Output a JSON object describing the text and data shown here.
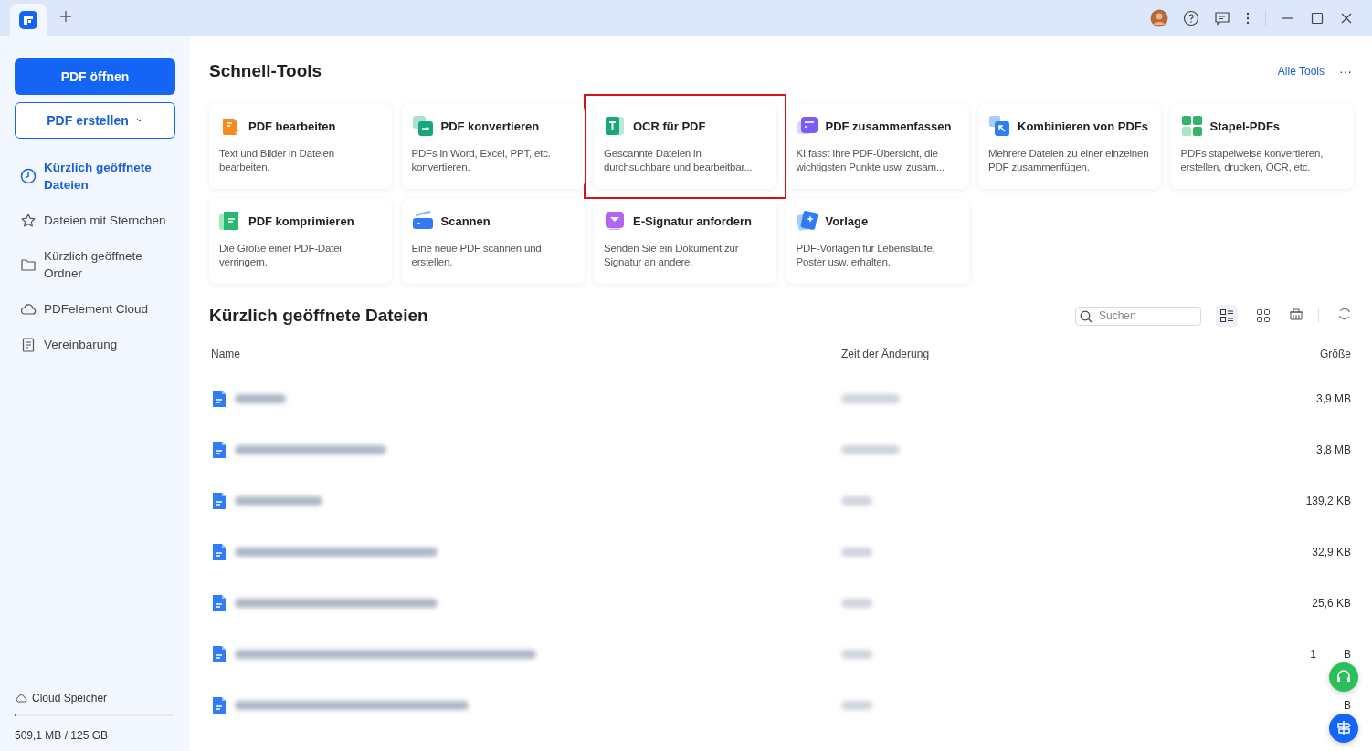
{
  "titlebar": {
    "tabs": [
      {
        "kind": "app",
        "selected": true
      }
    ]
  },
  "sidebar": {
    "open_button": "PDF öffnen",
    "create_button": "PDF erstellen",
    "items": [
      {
        "label": "Kürzlich geöffnete Dateien",
        "selected": true
      },
      {
        "label": "Dateien mit Sternchen",
        "selected": false
      },
      {
        "label": "Kürzlich geöffnete Ordner",
        "selected": false
      },
      {
        "label": "PDFelement Cloud",
        "selected": false
      },
      {
        "label": "Vereinbarung",
        "selected": false
      }
    ],
    "storage": {
      "label": "Cloud Speicher",
      "level": 0.01,
      "usage": "509,1 MB / 125 GB"
    }
  },
  "tools": {
    "title": "Schnell-Tools",
    "all_link": "Alle Tools",
    "more": "···",
    "items": [
      {
        "title": "PDF bearbeiten",
        "description": "Text und Bilder in Dateien bearbeiten.",
        "highlighted": false
      },
      {
        "title": "PDF konvertieren",
        "description": "PDFs in Word, Excel, PPT, etc. konvertieren.",
        "highlighted": false
      },
      {
        "title": "OCR für PDF",
        "description": "Gescannte Dateien in durchsuchbare und bearbeitbar...",
        "highlighted": true
      },
      {
        "title": "PDF zusammenfassen",
        "description": "KI fasst Ihre PDF-Übersicht, die wichtigsten Punkte usw. zusam...",
        "highlighted": false
      },
      {
        "title": "Kombinieren von PDFs",
        "description": "Mehrere Dateien zu einer einzelnen PDF zusammenfügen.",
        "highlighted": false
      },
      {
        "title": "Stapel-PDFs",
        "description": "PDFs stapelweise konvertieren, erstellen, drucken, OCR, etc.",
        "highlighted": false
      },
      {
        "title": "PDF komprimieren",
        "description": "Die Größe einer PDF-Datei verringern.",
        "highlighted": false
      },
      {
        "title": "Scannen",
        "description": "Eine neue PDF scannen und erstellen.",
        "highlighted": false
      },
      {
        "title": "E-Signatur anfordern",
        "description": "Senden Sie ein Dokument zur Signatur an andere.",
        "highlighted": false
      },
      {
        "title": "Vorlage",
        "description": "PDF-Vorlagen für Lebensläufe, Poster usw. erhalten.",
        "highlighted": false
      }
    ]
  },
  "recent": {
    "title": "Kürzlich geöffnete Dateien",
    "search": {
      "placeholder": "Suchen"
    },
    "views": [
      {
        "kind": "list",
        "selected": true
      },
      {
        "kind": "grid",
        "selected": false
      }
    ],
    "columns": [
      "Name",
      "Zeit der Änderung",
      "Größe"
    ],
    "rows": [
      {
        "size": "3,9 MB"
      },
      {
        "size": "3,8 MB"
      },
      {
        "size": "139,2 KB"
      },
      {
        "size": "32,9 KB"
      },
      {
        "size": "25,6 KB"
      },
      {
        "size": "1",
        "size_tail": "B"
      },
      {
        "size_tail": "B"
      }
    ]
  }
}
